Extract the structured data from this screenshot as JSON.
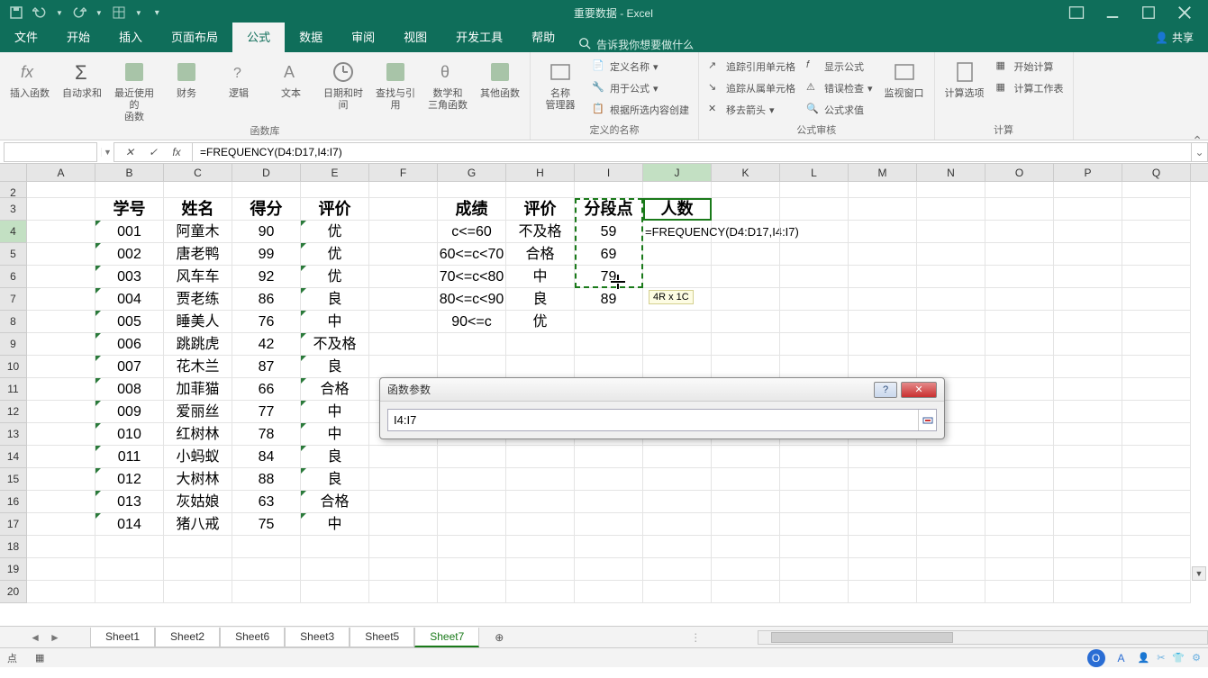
{
  "title": "重要数据 - Excel",
  "tabs": [
    "文件",
    "开始",
    "插入",
    "页面布局",
    "公式",
    "数据",
    "审阅",
    "视图",
    "开发工具",
    "帮助"
  ],
  "active_tab_index": 4,
  "tellme": "告诉我你想要做什么",
  "share": "共享",
  "ribbon": {
    "g1": {
      "insert_fn": "插入函数",
      "autosum": "自动求和",
      "recent": "最近使用的\n函数",
      "financial": "财务",
      "logical": "逻辑",
      "text": "文本",
      "datetime": "日期和时间",
      "lookup": "查找与引用",
      "math": "数学和\n三角函数",
      "other": "其他函数",
      "label": "函数库"
    },
    "g2": {
      "name_mgr": "名称\n管理器",
      "define": "定义名称",
      "usein": "用于公式",
      "fromsel": "根据所选内容创建",
      "label": "定义的名称"
    },
    "g3": {
      "trace_prec": "追踪引用单元格",
      "trace_dep": "追踪从属单元格",
      "remove_arrows": "移去箭头",
      "show_formulas": "显示公式",
      "error_check": "错误检查",
      "eval": "公式求值",
      "watch": "监视窗口",
      "label": "公式审核"
    },
    "g4": {
      "calc_opts": "计算选项",
      "calc_now": "开始计算",
      "calc_sheet": "计算工作表",
      "label": "计算"
    }
  },
  "name_box": "",
  "formula": "=FREQUENCY(D4:D17,I4:I7)",
  "columns": [
    "A",
    "B",
    "C",
    "D",
    "E",
    "F",
    "G",
    "H",
    "I",
    "J",
    "K",
    "L",
    "M",
    "N",
    "O",
    "P",
    "Q"
  ],
  "row_nums": [
    2,
    3,
    4,
    5,
    6,
    7,
    8,
    9,
    10,
    11,
    12,
    13,
    14,
    15,
    16,
    17,
    18,
    19,
    20
  ],
  "headers1": {
    "B": "学号",
    "C": "姓名",
    "D": "得分",
    "E": "评价",
    "G": "成绩",
    "H": "评价",
    "I": "分段点",
    "J": "人数"
  },
  "table1": [
    {
      "B": "001",
      "C": "阿童木",
      "D": "90",
      "E": "优"
    },
    {
      "B": "002",
      "C": "唐老鸭",
      "D": "99",
      "E": "优"
    },
    {
      "B": "003",
      "C": "风车车",
      "D": "92",
      "E": "优"
    },
    {
      "B": "004",
      "C": "贾老练",
      "D": "86",
      "E": "良"
    },
    {
      "B": "005",
      "C": "睡美人",
      "D": "76",
      "E": "中"
    },
    {
      "B": "006",
      "C": "跳跳虎",
      "D": "42",
      "E": "不及格"
    },
    {
      "B": "007",
      "C": "花木兰",
      "D": "87",
      "E": "良"
    },
    {
      "B": "008",
      "C": "加菲猫",
      "D": "66",
      "E": "合格"
    },
    {
      "B": "009",
      "C": "爱丽丝",
      "D": "77",
      "E": "中"
    },
    {
      "B": "010",
      "C": "红树林",
      "D": "78",
      "E": "中"
    },
    {
      "B": "011",
      "C": "小蚂蚁",
      "D": "84",
      "E": "良"
    },
    {
      "B": "012",
      "C": "大树林",
      "D": "88",
      "E": "良"
    },
    {
      "B": "013",
      "C": "灰姑娘",
      "D": "63",
      "E": "合格"
    },
    {
      "B": "014",
      "C": "猪八戒",
      "D": "75",
      "E": "中"
    }
  ],
  "table2": [
    {
      "G": "c<=60",
      "H": "不及格",
      "I": "59"
    },
    {
      "G": "60<=c<70",
      "H": "合格",
      "I": "69"
    },
    {
      "G": "70<=c<80",
      "H": "中",
      "I": "79"
    },
    {
      "G": "80<=c<90",
      "H": "良",
      "I": "89"
    },
    {
      "G": "90<=c",
      "H": "优",
      "I": ""
    }
  ],
  "j4_formula": "=FREQUENCY(D4:D17,I4:I7)",
  "sel_hint": "4R x 1C",
  "dialog": {
    "title": "函数参数",
    "value": "I4:I7"
  },
  "sheets": [
    "Sheet1",
    "Sheet2",
    "Sheet6",
    "Sheet3",
    "Sheet5",
    "Sheet7"
  ],
  "active_sheet_index": 5,
  "status_left": "点"
}
